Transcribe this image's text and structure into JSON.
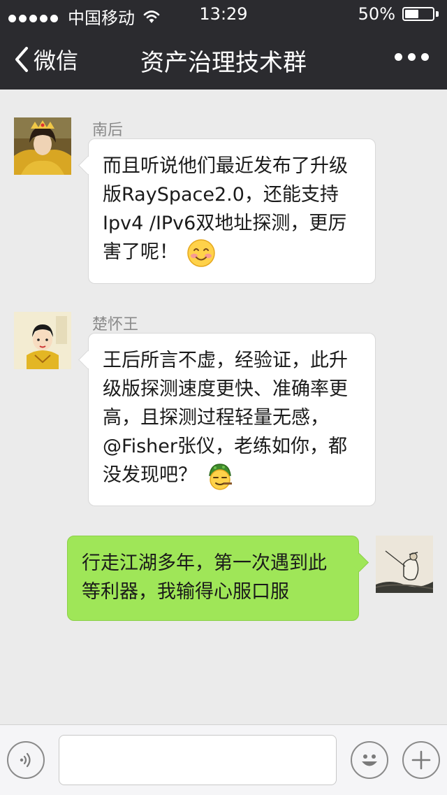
{
  "status_bar": {
    "carrier": "中国移动",
    "time": "13:29",
    "battery": "50%",
    "battery_level": 0.5
  },
  "nav": {
    "back_label": "微信",
    "title": "资产治理技术群"
  },
  "messages": [
    {
      "sender": "南后",
      "lines": [
        "而且听说他们最近发布了升级",
        "版RaySpace2.0，还能支持",
        "Ipv4 /IPv6双地址探测，更厉",
        "害了呢！"
      ],
      "emoji": "smiling-blush-emoji"
    },
    {
      "sender": "楚怀王",
      "lines": [
        "王后所言不虚，经验证，此升",
        "级版探测速度更快、准确率更",
        "高，且探测过程轻量无感，",
        "@Fisher张仪，老练如你，都",
        "没发现吧？"
      ],
      "emoji": "sly-green-face-emoji"
    },
    {
      "lines": [
        "行走江湖多年，第一次遇到此",
        "等利器，我输得心服口服"
      ]
    }
  ],
  "input": {
    "placeholder": ""
  },
  "colors": {
    "nav_bg": "#2b2b2f",
    "chat_bg": "#ebebeb",
    "incoming_bubble": "#ffffff",
    "outgoing_bubble": "#9fe658"
  }
}
